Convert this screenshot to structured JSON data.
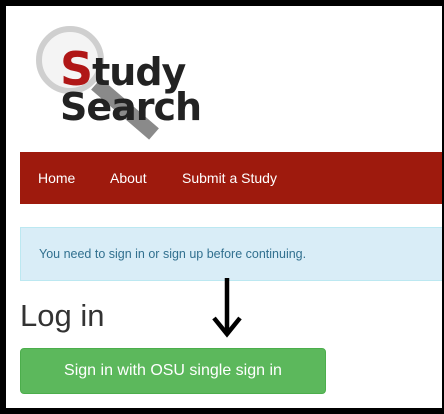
{
  "logo": {
    "line1_initial": "S",
    "line1_rest": "tudy",
    "line2": "Search"
  },
  "nav": {
    "items": [
      {
        "label": "Home"
      },
      {
        "label": "About"
      },
      {
        "label": "Submit a Study"
      }
    ]
  },
  "alert": {
    "text": "You need to sign in or sign up before continuing."
  },
  "page": {
    "title": "Log in"
  },
  "login": {
    "button_label": "Sign in with OSU single sign in"
  },
  "icons": {
    "logo_magnifier": "magnifier-icon",
    "annotation_arrow": "arrow-down-icon"
  },
  "colors": {
    "brand_red": "#9e1a0d",
    "alert_bg": "#d9edf7",
    "alert_text": "#31708f",
    "button_green": "#5cb85c"
  }
}
